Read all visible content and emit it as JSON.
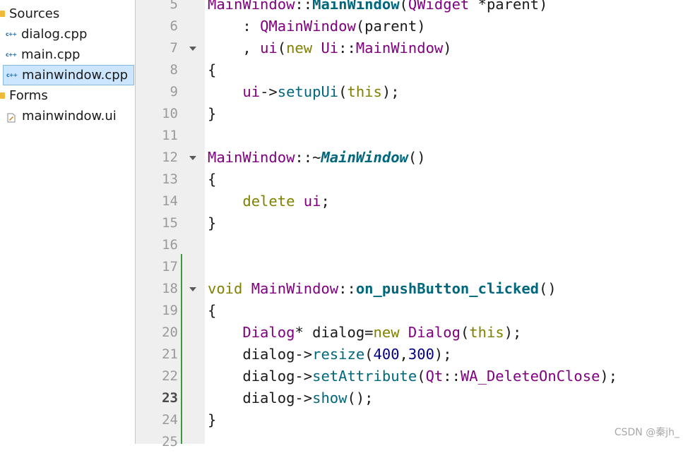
{
  "project_tree": {
    "items": [
      {
        "label": "Sources",
        "kind": "folder"
      },
      {
        "label": "dialog.cpp",
        "kind": "cpp"
      },
      {
        "label": "main.cpp",
        "kind": "cpp"
      },
      {
        "label": "mainwindow.cpp",
        "kind": "cpp",
        "selected": true
      },
      {
        "label": "Forms",
        "kind": "folder"
      },
      {
        "label": "mainwindow.ui",
        "kind": "ui"
      }
    ],
    "cpp_icon_text": "c++"
  },
  "editor": {
    "current_line": "23",
    "lines": [
      {
        "number": "5"
      },
      {
        "number": "6"
      },
      {
        "number": "7",
        "foldable": true
      },
      {
        "number": "8"
      },
      {
        "number": "9"
      },
      {
        "number": "10"
      },
      {
        "number": "11"
      },
      {
        "number": "12",
        "foldable": true
      },
      {
        "number": "13"
      },
      {
        "number": "14"
      },
      {
        "number": "15"
      },
      {
        "number": "16"
      },
      {
        "number": "17"
      },
      {
        "number": "18",
        "foldable": true
      },
      {
        "number": "19"
      },
      {
        "number": "20"
      },
      {
        "number": "21"
      },
      {
        "number": "22"
      },
      {
        "number": "23"
      },
      {
        "number": "24"
      },
      {
        "number": "25"
      }
    ],
    "code": [
      [
        {
          "c": "t",
          "x": "MainWindow"
        },
        {
          "c": "",
          "x": "::"
        },
        {
          "c": "fb",
          "x": "MainWindow"
        },
        {
          "c": "",
          "x": "("
        },
        {
          "c": "t",
          "x": "QWidget"
        },
        {
          "c": "",
          "x": " *parent)"
        }
      ],
      [
        {
          "c": "",
          "x": "    : "
        },
        {
          "c": "t",
          "x": "QMainWindow"
        },
        {
          "c": "",
          "x": "(parent)"
        }
      ],
      [
        {
          "c": "",
          "x": "    , "
        },
        {
          "c": "t",
          "x": "ui"
        },
        {
          "c": "",
          "x": "("
        },
        {
          "c": "k",
          "x": "new"
        },
        {
          "c": "",
          "x": " "
        },
        {
          "c": "t",
          "x": "Ui"
        },
        {
          "c": "",
          "x": "::"
        },
        {
          "c": "t",
          "x": "MainWindow"
        },
        {
          "c": "",
          "x": ")"
        }
      ],
      [
        {
          "c": "",
          "x": "{"
        }
      ],
      [
        {
          "c": "",
          "x": "    "
        },
        {
          "c": "t",
          "x": "ui"
        },
        {
          "c": "",
          "x": "->"
        },
        {
          "c": "f",
          "x": "setupUi"
        },
        {
          "c": "",
          "x": "("
        },
        {
          "c": "k",
          "x": "this"
        },
        {
          "c": "",
          "x": ");"
        }
      ],
      [
        {
          "c": "",
          "x": "}"
        }
      ],
      [],
      [
        {
          "c": "t",
          "x": "MainWindow"
        },
        {
          "c": "",
          "x": "::~"
        },
        {
          "c": "fbi",
          "x": "MainWindow"
        },
        {
          "c": "",
          "x": "()"
        }
      ],
      [
        {
          "c": "",
          "x": "{"
        }
      ],
      [
        {
          "c": "",
          "x": "    "
        },
        {
          "c": "k",
          "x": "delete"
        },
        {
          "c": "",
          "x": " "
        },
        {
          "c": "t",
          "x": "ui"
        },
        {
          "c": "",
          "x": ";"
        }
      ],
      [
        {
          "c": "",
          "x": "}"
        }
      ],
      [],
      [],
      [
        {
          "c": "k",
          "x": "void"
        },
        {
          "c": "",
          "x": " "
        },
        {
          "c": "t",
          "x": "MainWindow"
        },
        {
          "c": "",
          "x": "::"
        },
        {
          "c": "fb",
          "x": "on_pushButton_clicked"
        },
        {
          "c": "",
          "x": "()"
        }
      ],
      [
        {
          "c": "",
          "x": "{"
        }
      ],
      [
        {
          "c": "",
          "x": "    "
        },
        {
          "c": "t",
          "x": "Dialog"
        },
        {
          "c": "",
          "x": "* dialog="
        },
        {
          "c": "k",
          "x": "new"
        },
        {
          "c": "",
          "x": " "
        },
        {
          "c": "t",
          "x": "Dialog"
        },
        {
          "c": "",
          "x": "("
        },
        {
          "c": "k",
          "x": "this"
        },
        {
          "c": "",
          "x": ");"
        }
      ],
      [
        {
          "c": "",
          "x": "    dialog->"
        },
        {
          "c": "f",
          "x": "resize"
        },
        {
          "c": "",
          "x": "("
        },
        {
          "c": "n",
          "x": "400"
        },
        {
          "c": "",
          "x": ","
        },
        {
          "c": "n",
          "x": "300"
        },
        {
          "c": "",
          "x": ");"
        }
      ],
      [
        {
          "c": "",
          "x": "    dialog->"
        },
        {
          "c": "f",
          "x": "setAttribute"
        },
        {
          "c": "",
          "x": "("
        },
        {
          "c": "t",
          "x": "Qt"
        },
        {
          "c": "",
          "x": "::"
        },
        {
          "c": "t",
          "x": "WA_DeleteOnClose"
        },
        {
          "c": "",
          "x": ");"
        }
      ],
      [
        {
          "c": "",
          "x": "    dialog->"
        },
        {
          "c": "f",
          "x": "show"
        },
        {
          "c": "",
          "x": "();"
        }
      ],
      [
        {
          "c": "",
          "x": "}"
        }
      ],
      []
    ]
  },
  "watermark": "CSDN @秦jh_",
  "colors": {
    "keyword": "#808000",
    "type": "#800080",
    "function": "#00677c",
    "number": "#000080",
    "gutter": "#efefef",
    "selection": "#cce6ff",
    "change_bar": "#3a9a3a"
  }
}
